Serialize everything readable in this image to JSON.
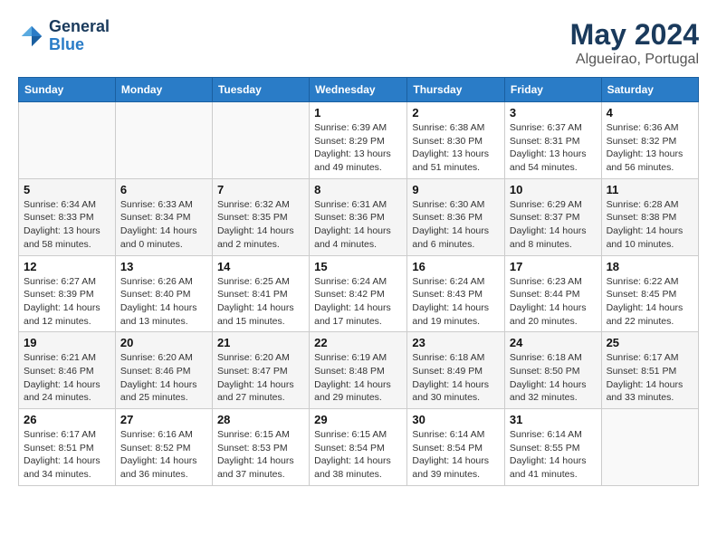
{
  "header": {
    "logo_line1": "General",
    "logo_line2": "Blue",
    "month": "May 2024",
    "location": "Algueirao, Portugal"
  },
  "weekdays": [
    "Sunday",
    "Monday",
    "Tuesday",
    "Wednesday",
    "Thursday",
    "Friday",
    "Saturday"
  ],
  "weeks": [
    [
      {
        "day": "",
        "info": ""
      },
      {
        "day": "",
        "info": ""
      },
      {
        "day": "",
        "info": ""
      },
      {
        "day": "1",
        "info": "Sunrise: 6:39 AM\nSunset: 8:29 PM\nDaylight: 13 hours\nand 49 minutes."
      },
      {
        "day": "2",
        "info": "Sunrise: 6:38 AM\nSunset: 8:30 PM\nDaylight: 13 hours\nand 51 minutes."
      },
      {
        "day": "3",
        "info": "Sunrise: 6:37 AM\nSunset: 8:31 PM\nDaylight: 13 hours\nand 54 minutes."
      },
      {
        "day": "4",
        "info": "Sunrise: 6:36 AM\nSunset: 8:32 PM\nDaylight: 13 hours\nand 56 minutes."
      }
    ],
    [
      {
        "day": "5",
        "info": "Sunrise: 6:34 AM\nSunset: 8:33 PM\nDaylight: 13 hours\nand 58 minutes."
      },
      {
        "day": "6",
        "info": "Sunrise: 6:33 AM\nSunset: 8:34 PM\nDaylight: 14 hours\nand 0 minutes."
      },
      {
        "day": "7",
        "info": "Sunrise: 6:32 AM\nSunset: 8:35 PM\nDaylight: 14 hours\nand 2 minutes."
      },
      {
        "day": "8",
        "info": "Sunrise: 6:31 AM\nSunset: 8:36 PM\nDaylight: 14 hours\nand 4 minutes."
      },
      {
        "day": "9",
        "info": "Sunrise: 6:30 AM\nSunset: 8:36 PM\nDaylight: 14 hours\nand 6 minutes."
      },
      {
        "day": "10",
        "info": "Sunrise: 6:29 AM\nSunset: 8:37 PM\nDaylight: 14 hours\nand 8 minutes."
      },
      {
        "day": "11",
        "info": "Sunrise: 6:28 AM\nSunset: 8:38 PM\nDaylight: 14 hours\nand 10 minutes."
      }
    ],
    [
      {
        "day": "12",
        "info": "Sunrise: 6:27 AM\nSunset: 8:39 PM\nDaylight: 14 hours\nand 12 minutes."
      },
      {
        "day": "13",
        "info": "Sunrise: 6:26 AM\nSunset: 8:40 PM\nDaylight: 14 hours\nand 13 minutes."
      },
      {
        "day": "14",
        "info": "Sunrise: 6:25 AM\nSunset: 8:41 PM\nDaylight: 14 hours\nand 15 minutes."
      },
      {
        "day": "15",
        "info": "Sunrise: 6:24 AM\nSunset: 8:42 PM\nDaylight: 14 hours\nand 17 minutes."
      },
      {
        "day": "16",
        "info": "Sunrise: 6:24 AM\nSunset: 8:43 PM\nDaylight: 14 hours\nand 19 minutes."
      },
      {
        "day": "17",
        "info": "Sunrise: 6:23 AM\nSunset: 8:44 PM\nDaylight: 14 hours\nand 20 minutes."
      },
      {
        "day": "18",
        "info": "Sunrise: 6:22 AM\nSunset: 8:45 PM\nDaylight: 14 hours\nand 22 minutes."
      }
    ],
    [
      {
        "day": "19",
        "info": "Sunrise: 6:21 AM\nSunset: 8:46 PM\nDaylight: 14 hours\nand 24 minutes."
      },
      {
        "day": "20",
        "info": "Sunrise: 6:20 AM\nSunset: 8:46 PM\nDaylight: 14 hours\nand 25 minutes."
      },
      {
        "day": "21",
        "info": "Sunrise: 6:20 AM\nSunset: 8:47 PM\nDaylight: 14 hours\nand 27 minutes."
      },
      {
        "day": "22",
        "info": "Sunrise: 6:19 AM\nSunset: 8:48 PM\nDaylight: 14 hours\nand 29 minutes."
      },
      {
        "day": "23",
        "info": "Sunrise: 6:18 AM\nSunset: 8:49 PM\nDaylight: 14 hours\nand 30 minutes."
      },
      {
        "day": "24",
        "info": "Sunrise: 6:18 AM\nSunset: 8:50 PM\nDaylight: 14 hours\nand 32 minutes."
      },
      {
        "day": "25",
        "info": "Sunrise: 6:17 AM\nSunset: 8:51 PM\nDaylight: 14 hours\nand 33 minutes."
      }
    ],
    [
      {
        "day": "26",
        "info": "Sunrise: 6:17 AM\nSunset: 8:51 PM\nDaylight: 14 hours\nand 34 minutes."
      },
      {
        "day": "27",
        "info": "Sunrise: 6:16 AM\nSunset: 8:52 PM\nDaylight: 14 hours\nand 36 minutes."
      },
      {
        "day": "28",
        "info": "Sunrise: 6:15 AM\nSunset: 8:53 PM\nDaylight: 14 hours\nand 37 minutes."
      },
      {
        "day": "29",
        "info": "Sunrise: 6:15 AM\nSunset: 8:54 PM\nDaylight: 14 hours\nand 38 minutes."
      },
      {
        "day": "30",
        "info": "Sunrise: 6:14 AM\nSunset: 8:54 PM\nDaylight: 14 hours\nand 39 minutes."
      },
      {
        "day": "31",
        "info": "Sunrise: 6:14 AM\nSunset: 8:55 PM\nDaylight: 14 hours\nand 41 minutes."
      },
      {
        "day": "",
        "info": ""
      }
    ]
  ]
}
